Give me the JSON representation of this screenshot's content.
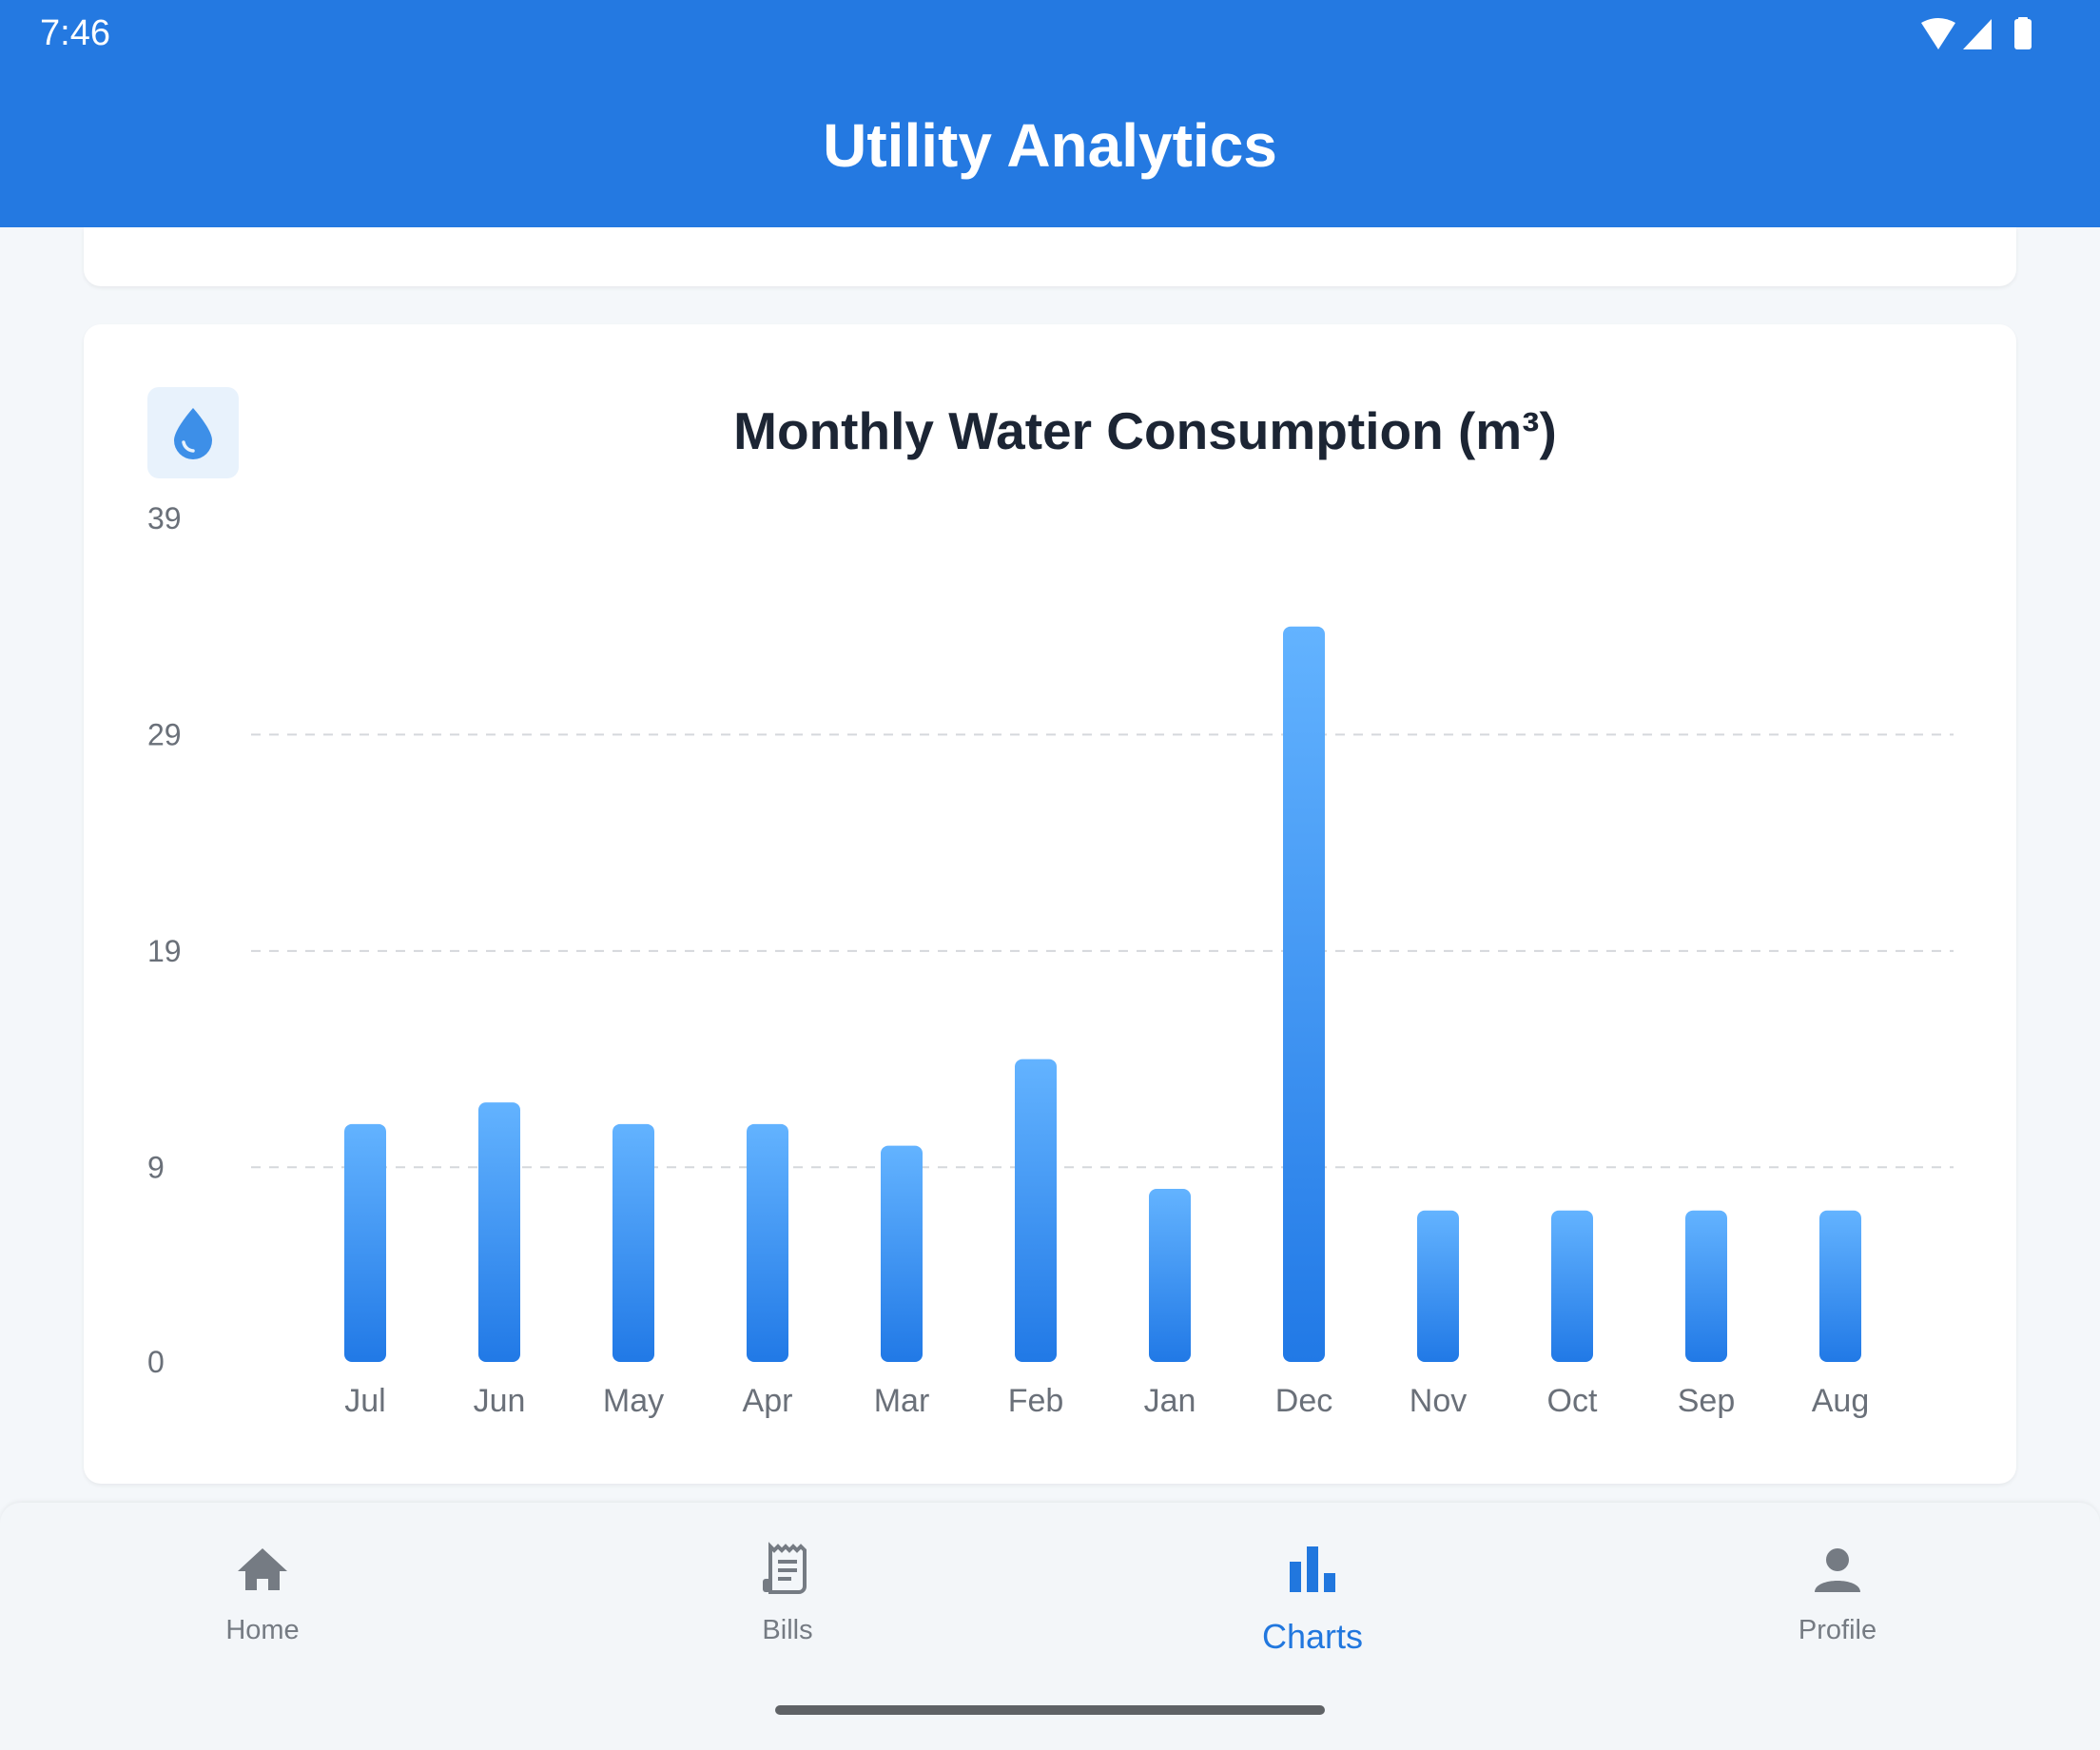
{
  "status_bar": {
    "time": "7:46"
  },
  "app_bar": {
    "title": "Utility Analytics"
  },
  "chart_card": {
    "icon": "water-drop-icon",
    "title": "Monthly Water Consumption (m³)"
  },
  "chart_data": {
    "type": "bar",
    "title": "Monthly Water Consumption (m³)",
    "categories": [
      "Jul",
      "Jun",
      "May",
      "Apr",
      "Mar",
      "Feb",
      "Jan",
      "Dec",
      "Nov",
      "Oct",
      "Sep",
      "Aug"
    ],
    "values": [
      11,
      12,
      11,
      11,
      10,
      14,
      8,
      34,
      7,
      7,
      7,
      7
    ],
    "yticks": [
      0,
      9,
      19,
      29,
      39
    ],
    "ylim": [
      0,
      39
    ],
    "grid": "dashed horizontal",
    "bar_color_top": "#63b3ff",
    "bar_color_bottom": "#2179e6"
  },
  "bottom_nav": {
    "items": [
      {
        "label": "Home",
        "icon": "home-icon"
      },
      {
        "label": "Bills",
        "icon": "receipt-icon"
      },
      {
        "label": "Charts",
        "icon": "bar-chart-icon",
        "active": true
      },
      {
        "label": "Profile",
        "icon": "person-icon"
      }
    ]
  },
  "colors": {
    "primary": "#2479e1",
    "active_nav": "#2177de",
    "inactive_nav": "#757b83"
  }
}
